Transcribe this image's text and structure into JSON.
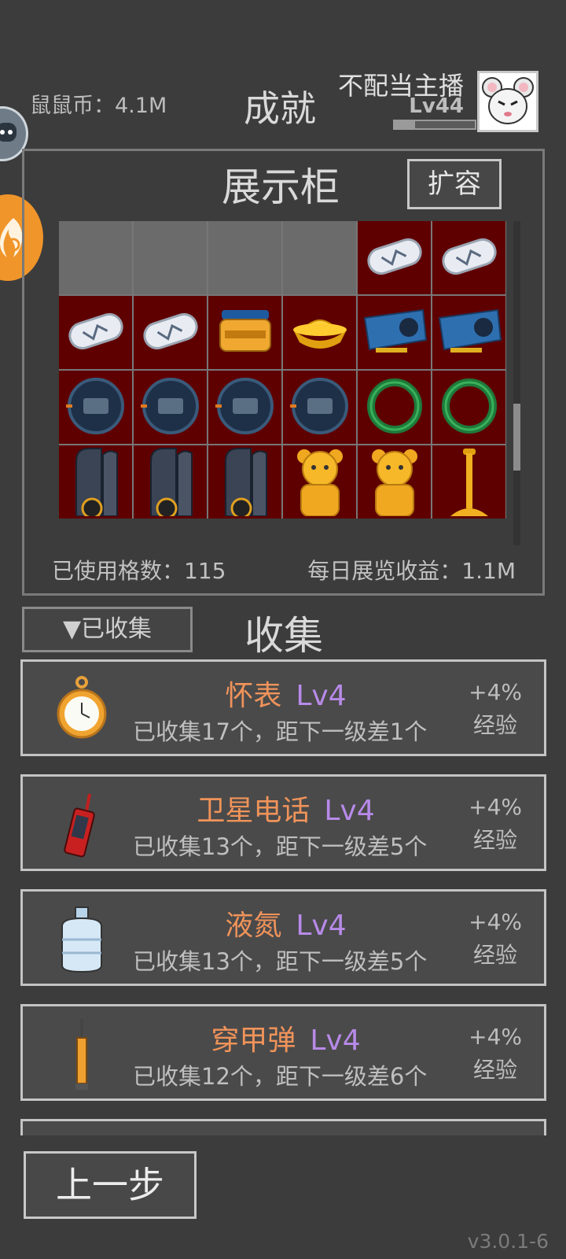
{
  "header": {
    "coins_label": "鼠鼠币：4.1M",
    "title": "成就",
    "player_name": "不配当主播",
    "player_level": "Lv44",
    "exp_progress": 0.25
  },
  "showcase": {
    "title": "展示柜",
    "expand_label": "扩容",
    "used_label": "已使用格数：115",
    "income_label": "每日展览收益：1.1M",
    "cells": [
      "empty",
      "empty",
      "empty",
      "empty",
      "pill",
      "pill",
      "pill",
      "pill",
      "jar",
      "gold-ingot",
      "gpu-card",
      "gpu-card",
      "watch",
      "watch",
      "watch",
      "watch",
      "jade-ring",
      "jade-ring",
      "radio",
      "radio",
      "radio",
      "gold-bear",
      "gold-bear",
      "gold-stand"
    ]
  },
  "collection": {
    "filter_label": "▼已收集",
    "title": "收集",
    "items": [
      {
        "icon": "pocket-watch-icon",
        "name": "怀表",
        "level": "Lv4",
        "desc": "已收集17个，距下一级差1个",
        "bonus": "+4%",
        "bonus_type": "经验"
      },
      {
        "icon": "satellite-phone-icon",
        "name": "卫星电话",
        "level": "Lv4",
        "desc": "已收集13个，距下一级差5个",
        "bonus": "+4%",
        "bonus_type": "经验"
      },
      {
        "icon": "liquid-nitrogen-icon",
        "name": "液氮",
        "level": "Lv4",
        "desc": "已收集13个，距下一级差5个",
        "bonus": "+4%",
        "bonus_type": "经验"
      },
      {
        "icon": "ap-round-icon",
        "name": "穿甲弹",
        "level": "Lv4",
        "desc": "已收集12个，距下一级差6个",
        "bonus": "+4%",
        "bonus_type": "经验"
      }
    ]
  },
  "footer": {
    "back_label": "上一步",
    "version": "v3.0.1-6"
  }
}
